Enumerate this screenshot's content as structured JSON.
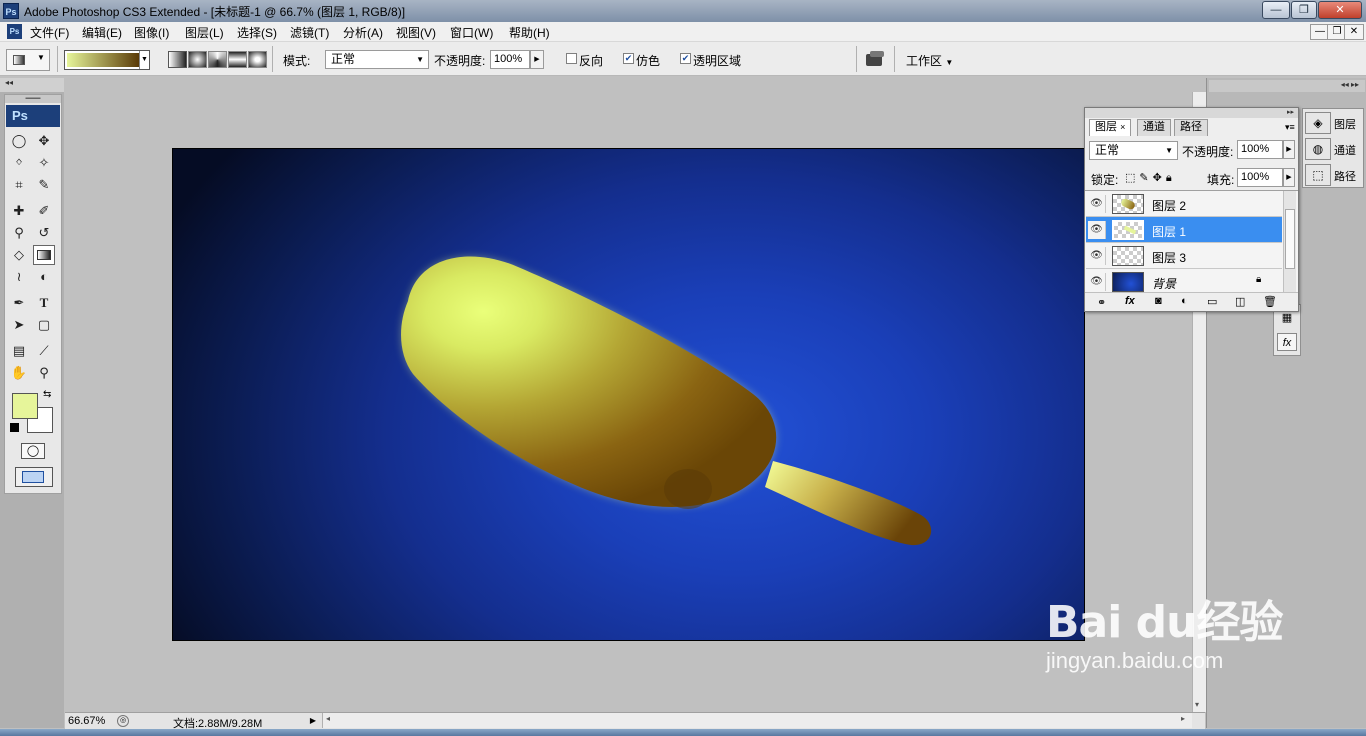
{
  "window": {
    "title": "Adobe Photoshop CS3 Extended - [未标题-1 @ 66.7% (图层 1, RGB/8)]",
    "app_icon": "Ps",
    "controls": [
      "—",
      "❐",
      "✕"
    ]
  },
  "menu": {
    "items": [
      "文件(F)",
      "编辑(E)",
      "图像(I)",
      "图层(L)",
      "选择(S)",
      "滤镜(T)",
      "分析(A)",
      "视图(V)",
      "窗口(W)",
      "帮助(H)"
    ],
    "doc_controls": [
      "—",
      "❐",
      "✕"
    ]
  },
  "options": {
    "mode_label": "模式:",
    "mode_value": "正常",
    "opacity_label": "不透明度:",
    "opacity_value": "100%",
    "reverse_label": "反向",
    "dither_label": "仿色",
    "transparency_label": "透明区域",
    "dither_checked": true,
    "transparency_checked": true,
    "reverse_checked": false,
    "workspace_label": "工作区"
  },
  "toolbox": {
    "brand": "Ps",
    "fg_color": "#e6f59a",
    "bg_color": "#ffffff"
  },
  "status": {
    "zoom": "66.67%",
    "doc_size": "文档:2.88M/9.28M"
  },
  "layers_panel": {
    "tabs": [
      "图层",
      "通道",
      "路径"
    ],
    "blend_mode": "正常",
    "opacity_label": "不透明度:",
    "opacity_value": "100%",
    "lock_label": "锁定:",
    "fill_label": "填充:",
    "fill_value": "100%",
    "layers": [
      {
        "name": "图层 2",
        "selected": false
      },
      {
        "name": "图层 1",
        "selected": true
      },
      {
        "name": "图层 3",
        "selected": false
      },
      {
        "name": "背景",
        "selected": false,
        "locked": true
      }
    ]
  },
  "dock": {
    "items": [
      "图层",
      "通道",
      "路径"
    ]
  },
  "watermark": {
    "brand": "Bai du经验",
    "url": "jingyan.baidu.com"
  }
}
